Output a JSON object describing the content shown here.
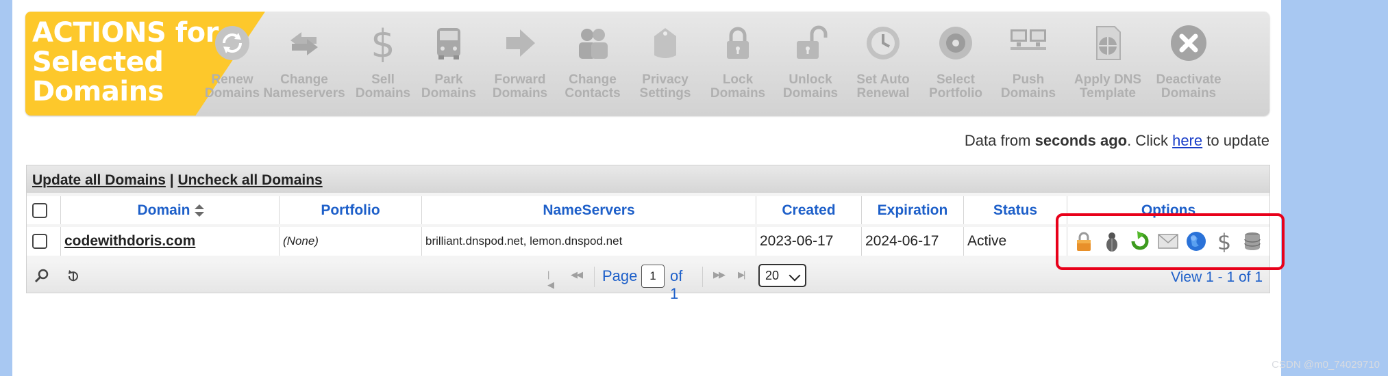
{
  "action_bar": {
    "title": "ACTIONS for Selected Domains",
    "actions": [
      {
        "line1": "Renew",
        "line2": "Domains",
        "icon": "renew-icon"
      },
      {
        "line1": "Change",
        "line2": "Nameservers",
        "icon": "change-nameservers-icon"
      },
      {
        "line1": "Sell",
        "line2": "Domains",
        "icon": "dollar-icon"
      },
      {
        "line1": "Park",
        "line2": "Domains",
        "icon": "park-icon"
      },
      {
        "line1": "Forward",
        "line2": "Domains",
        "icon": "forward-icon"
      },
      {
        "line1": "Change",
        "line2": "Contacts",
        "icon": "contacts-icon"
      },
      {
        "line1": "Privacy",
        "line2": "Settings",
        "icon": "privacy-icon"
      },
      {
        "line1": "Lock",
        "line2": "Domains",
        "icon": "lock-icon"
      },
      {
        "line1": "Unlock",
        "line2": "Domains",
        "icon": "unlock-icon"
      },
      {
        "line1": "Set Auto",
        "line2": "Renewal",
        "icon": "auto-renewal-icon"
      },
      {
        "line1": "Select",
        "line2": "Portfolio",
        "icon": "portfolio-icon"
      },
      {
        "line1": "Push",
        "line2": "Domains",
        "icon": "push-icon"
      },
      {
        "line1": "Apply DNS",
        "line2": "Template",
        "icon": "dns-template-icon"
      },
      {
        "line1": "Deactivate",
        "line2": "Domains",
        "icon": "deactivate-icon"
      }
    ]
  },
  "update_info": {
    "prefix": "Data from ",
    "age": "seconds ago",
    "middle": ". Click ",
    "link": "here",
    "suffix": " to update"
  },
  "grid": {
    "top_links": {
      "update_all": "Update all Domains",
      "separator": "|",
      "uncheck_all": "Uncheck all Domains"
    },
    "columns": [
      "Domain",
      "Portfolio",
      "NameServers",
      "Created",
      "Expiration",
      "Status",
      "Options"
    ],
    "rows": [
      {
        "domain": "codewithdoris.com",
        "portfolio": "(None)",
        "nameservers": "brilliant.dnspod.net, lemon.dnspod.net",
        "created": "2023-06-17",
        "expiration": "2024-06-17",
        "status": "Active",
        "option_icons": [
          "lock-icon",
          "bug-icon",
          "refresh-arrow-icon",
          "mail-icon",
          "globe-icon",
          "dollar-icon",
          "database-icon"
        ]
      }
    ],
    "pager": {
      "page_label": "Page",
      "page_value": "1",
      "of_label": "of 1",
      "rows_per_page": "20",
      "view_info": "View 1 - 1 of 1"
    }
  },
  "colors": {
    "brand_yellow": "#fdc82b",
    "link_blue": "#1d5fc9",
    "highlight_red": "#e8001a",
    "background_blue": "#a8c8f2"
  },
  "watermark": "CSDN @m0_74029710"
}
